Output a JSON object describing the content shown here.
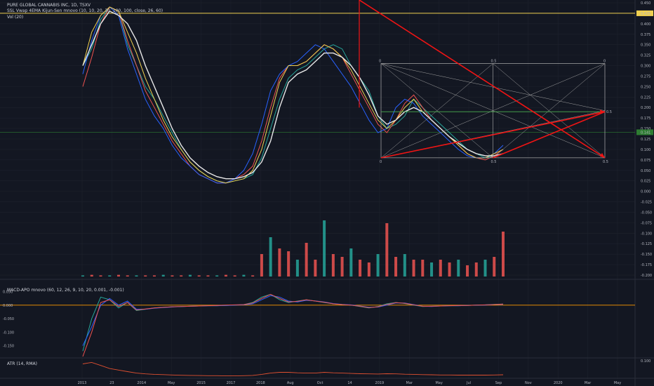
{
  "header": {
    "symbol": "PURE GLOBAL CANNABIS INC, 1D, TSXV",
    "indicator1": "SSL Vwap 4EMA Kijun-Sen mnovo (10, 10, 20, 30, 100, 100, close, 26, 60)",
    "indicator2": "Vol (20)"
  },
  "panes": {
    "macd_title": "MACD-APO mnovo (60, 12, 26, 9, 10, 20, 0.001, -0.001)",
    "atr_title": "ATR (14, RMA)"
  },
  "colors": {
    "background": "#131722",
    "grid": "#1e222d",
    "up": "#26a69a",
    "down": "#ef5350",
    "yellow_line": "#f0d050",
    "green_level": "#4caf50",
    "red_arrows": "#f01414",
    "white": "#e8e8e8",
    "blue": "#2962ff",
    "orange": "#ff9800"
  },
  "chart_data": [
    {
      "type": "line",
      "pane": "price",
      "yaxis_ticks": [
        "0.450",
        "0.425",
        "0.400",
        "0.375",
        "0.350",
        "0.325",
        "0.300",
        "0.275",
        "0.250",
        "0.225",
        "0.200",
        "0.175",
        "0.150",
        "0.125",
        "0.100",
        "0.075",
        "0.050",
        "0.025",
        "0.000",
        "-0.025",
        "-0.050",
        "-0.075",
        "-0.100",
        "-0.125",
        "-0.150",
        "-0.175",
        "-0.200"
      ],
      "xaxis_ticks": [
        "2013",
        "23",
        "2014",
        "May",
        "2015",
        "2017",
        "2018",
        "Aug",
        "Oct",
        "14",
        "2019",
        "Mar",
        "May",
        "Jul",
        "Sep",
        "Nov",
        "2020",
        "Mar",
        "May"
      ],
      "ylim": [
        -0.2,
        0.45
      ],
      "price_labels": {
        "current": "0.141",
        "resistance": "0.425"
      },
      "fib_labels": [
        "0",
        "0.5",
        "0",
        "0.5",
        "0",
        "0.5"
      ],
      "fib_mid_label": "0.5",
      "series": [
        {
          "values": [
            0.3,
            0.34,
            0.41,
            0.44,
            0.43,
            0.35,
            0.3,
            0.25,
            0.22,
            0.18,
            0.14,
            0.1,
            0.07,
            0.05,
            0.035,
            0.025,
            0.02,
            0.025,
            0.03,
            0.04,
            0.08,
            0.15,
            0.22,
            0.27,
            0.29,
            0.3,
            0.32,
            0.34,
            0.35,
            0.34,
            0.3,
            0.27,
            0.24,
            0.18,
            0.15,
            0.16,
            0.18,
            0.22,
            0.2,
            0.18,
            0.16,
            0.14,
            0.12,
            0.1,
            0.09,
            0.08,
            0.085,
            0.09
          ]
        },
        {
          "values": [
            0.25,
            0.32,
            0.4,
            0.44,
            0.43,
            0.36,
            0.3,
            0.24,
            0.2,
            0.16,
            0.12,
            0.09,
            0.06,
            0.04,
            0.03,
            0.02,
            0.02,
            0.03,
            0.04,
            0.06,
            0.12,
            0.2,
            0.27,
            0.3,
            0.3,
            0.31,
            0.33,
            0.35,
            0.34,
            0.32,
            0.28,
            0.24,
            0.2,
            0.16,
            0.14,
            0.17,
            0.21,
            0.23,
            0.2,
            0.17,
            0.15,
            0.13,
            0.11,
            0.09,
            0.08,
            0.075,
            0.085,
            0.1
          ]
        },
        {
          "values": [
            0.28,
            0.36,
            0.42,
            0.44,
            0.42,
            0.34,
            0.28,
            0.22,
            0.18,
            0.15,
            0.11,
            0.08,
            0.06,
            0.04,
            0.03,
            0.02,
            0.02,
            0.03,
            0.05,
            0.09,
            0.16,
            0.24,
            0.28,
            0.3,
            0.31,
            0.33,
            0.35,
            0.34,
            0.31,
            0.28,
            0.25,
            0.21,
            0.17,
            0.14,
            0.15,
            0.2,
            0.22,
            0.21,
            0.18,
            0.16,
            0.14,
            0.12,
            0.1,
            0.085,
            0.08,
            0.08,
            0.09,
            0.11
          ]
        },
        {
          "values": [
            0.3,
            0.38,
            0.42,
            0.44,
            0.43,
            0.38,
            0.33,
            0.27,
            0.22,
            0.17,
            0.13,
            0.1,
            0.07,
            0.05,
            0.035,
            0.025,
            0.02,
            0.025,
            0.03,
            0.05,
            0.1,
            0.18,
            0.26,
            0.3,
            0.3,
            0.31,
            0.33,
            0.35,
            0.34,
            0.32,
            0.29,
            0.25,
            0.21,
            0.17,
            0.15,
            0.17,
            0.2,
            0.22,
            0.19,
            0.17,
            0.15,
            0.13,
            0.11,
            0.09,
            0.08,
            0.08,
            0.09,
            0.1
          ]
        },
        {
          "values": [
            0.3,
            0.35,
            0.4,
            0.43,
            0.42,
            0.4,
            0.36,
            0.3,
            0.25,
            0.2,
            0.15,
            0.11,
            0.08,
            0.06,
            0.045,
            0.035,
            0.03,
            0.03,
            0.035,
            0.045,
            0.07,
            0.12,
            0.2,
            0.26,
            0.28,
            0.29,
            0.31,
            0.33,
            0.33,
            0.32,
            0.3,
            0.27,
            0.23,
            0.18,
            0.16,
            0.17,
            0.19,
            0.2,
            0.19,
            0.17,
            0.15,
            0.13,
            0.115,
            0.1,
            0.09,
            0.085,
            0.085,
            0.09
          ]
        }
      ]
    },
    {
      "type": "bar",
      "pane": "volume",
      "values": [
        0.02,
        0.03,
        0.02,
        0.02,
        0.03,
        0.02,
        0.02,
        0.02,
        0.02,
        0.03,
        0.02,
        0.02,
        0.03,
        0.02,
        0.02,
        0.02,
        0.03,
        0.02,
        0.03,
        0.02,
        0.4,
        0.7,
        0.5,
        0.45,
        0.3,
        0.6,
        0.3,
        1.0,
        0.4,
        0.35,
        0.5,
        0.3,
        0.25,
        0.4,
        0.95,
        0.35,
        0.4,
        0.3,
        0.3,
        0.25,
        0.3,
        0.25,
        0.3,
        0.2,
        0.25,
        0.3,
        0.35,
        0.8
      ]
    },
    {
      "type": "line",
      "pane": "macd",
      "yaxis_ticks": [
        "0.050",
        "0.000",
        "-0.050",
        "-0.100",
        "-0.150"
      ],
      "ylim": [
        -0.19,
        0.08
      ],
      "series": [
        {
          "values": [
            -0.17,
            -0.05,
            0.03,
            0.02,
            -0.01,
            0.01,
            -0.02,
            -0.015,
            -0.01,
            -0.008,
            -0.006,
            -0.005,
            -0.004,
            -0.003,
            -0.002,
            -0.002,
            -0.001,
            0.0,
            0.002,
            0.01,
            0.03,
            0.04,
            0.02,
            0.01,
            0.015,
            0.02,
            0.015,
            0.01,
            0.005,
            0.002,
            0.0,
            -0.005,
            -0.01,
            -0.005,
            0.005,
            0.01,
            0.006,
            0.0,
            -0.005,
            -0.004,
            -0.003,
            -0.002,
            -0.002,
            -0.001,
            0.0,
            0.001,
            0.003,
            0.004
          ]
        },
        {
          "values": [
            -0.15,
            -0.08,
            0.0,
            0.025,
            0.0,
            0.015,
            -0.015,
            -0.015,
            -0.011,
            -0.009,
            -0.007,
            -0.005,
            -0.004,
            -0.003,
            -0.002,
            -0.002,
            -0.001,
            0.0,
            0.001,
            0.005,
            0.02,
            0.035,
            0.03,
            0.015,
            0.012,
            0.018,
            0.016,
            0.012,
            0.006,
            0.003,
            0.001,
            -0.003,
            -0.008,
            -0.007,
            0.0,
            0.008,
            0.008,
            0.002,
            -0.004,
            -0.005,
            -0.003,
            -0.002,
            -0.002,
            -0.001,
            0.0,
            0.0,
            0.002,
            0.003
          ]
        },
        {
          "values": [
            -0.19,
            -0.1,
            0.01,
            0.02,
            -0.005,
            0.01,
            -0.018,
            -0.014,
            -0.01,
            -0.008,
            -0.006,
            -0.005,
            -0.004,
            -0.003,
            -0.002,
            -0.001,
            0.0,
            0.001,
            0.002,
            0.008,
            0.025,
            0.04,
            0.025,
            0.012,
            0.014,
            0.02,
            0.015,
            0.011,
            0.005,
            0.002,
            0.0,
            -0.004,
            -0.009,
            -0.006,
            0.003,
            0.009,
            0.007,
            0.001,
            -0.004,
            -0.004,
            -0.003,
            -0.002,
            -0.001,
            -0.001,
            0.0,
            0.001,
            0.002,
            0.004
          ]
        }
      ]
    },
    {
      "type": "line",
      "pane": "atr",
      "yaxis_ticks": [
        "0.100"
      ],
      "ylim": [
        0.0,
        0.11
      ],
      "series": [
        {
          "values": [
            0.08,
            0.09,
            0.07,
            0.05,
            0.04,
            0.03,
            0.02,
            0.015,
            0.012,
            0.01,
            0.008,
            0.006,
            0.005,
            0.004,
            0.003,
            0.003,
            0.002,
            0.002,
            0.003,
            0.005,
            0.012,
            0.02,
            0.025,
            0.025,
            0.022,
            0.02,
            0.02,
            0.025,
            0.022,
            0.02,
            0.018,
            0.016,
            0.015,
            0.014,
            0.016,
            0.015,
            0.013,
            0.012,
            0.01,
            0.009,
            0.008,
            0.008,
            0.007,
            0.007,
            0.007,
            0.007,
            0.008,
            0.009
          ]
        }
      ]
    }
  ]
}
